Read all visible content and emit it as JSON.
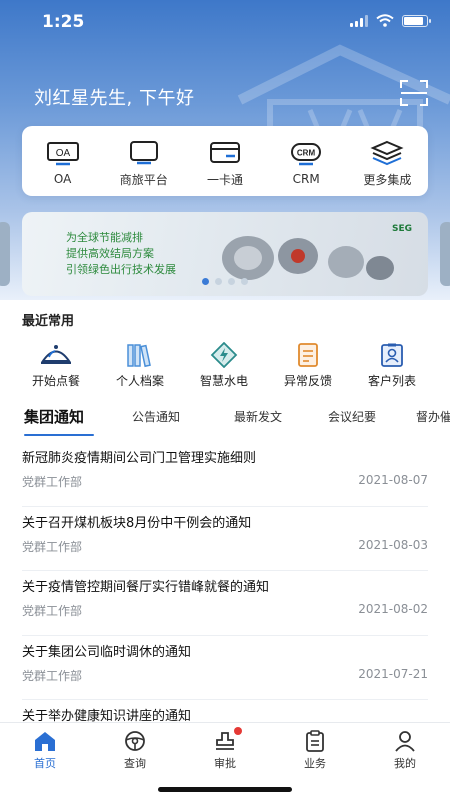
{
  "status_bar": {
    "time": "1:25",
    "battery_level": 0.85,
    "signal_icon": "signal-icon",
    "wifi_icon": "wifi-icon"
  },
  "header": {
    "greeting": "刘红星先生, 下午好",
    "scan_icon": "scan-icon"
  },
  "quick_apps": [
    {
      "label": "OA",
      "icon": "oa-icon"
    },
    {
      "label": "商旅平台",
      "icon": "travel-platform-icon"
    },
    {
      "label": "一卡通",
      "icon": "card-icon"
    },
    {
      "label": "CRM",
      "icon": "crm-icon"
    },
    {
      "label": "更多集成",
      "icon": "layers-icon"
    }
  ],
  "banner": {
    "lines": [
      "为全球节能减排",
      "提供高效结局方案",
      "引领绿色出行技术发展"
    ],
    "logo": "SEG",
    "page_count": 4,
    "active_page": 1
  },
  "recent": {
    "title": "最近常用",
    "items": [
      {
        "label": "开始点餐",
        "icon": "cloche-icon"
      },
      {
        "label": "个人档案",
        "icon": "books-icon"
      },
      {
        "label": "智慧水电",
        "icon": "energy-icon"
      },
      {
        "label": "异常反馈",
        "icon": "report-icon"
      },
      {
        "label": "客户列表",
        "icon": "contact-card-icon"
      }
    ]
  },
  "tabs": [
    "集团通知",
    "公告通知",
    "最新发文",
    "会议纪要",
    "督办催"
  ],
  "active_tab": 0,
  "news": [
    {
      "title": "新冠肺炎疫情期间公司门卫管理实施细则",
      "dept": "党群工作部",
      "date": "2021-08-07"
    },
    {
      "title": "关于召开煤机板块8月份中干例会的通知",
      "dept": "党群工作部",
      "date": "2021-08-03"
    },
    {
      "title": "关于疫情管控期间餐厅实行错峰就餐的通知",
      "dept": "党群工作部",
      "date": "2021-08-02"
    },
    {
      "title": "关于集团公司临时调休的通知",
      "dept": "党群工作部",
      "date": "2021-07-21"
    },
    {
      "title": "关于举办健康知识讲座的通知",
      "dept": "",
      "date": ""
    }
  ],
  "bottom_nav": [
    {
      "label": "首页",
      "icon": "home-icon",
      "active": true
    },
    {
      "label": "查询",
      "icon": "steering-wheel-icon"
    },
    {
      "label": "审批",
      "icon": "stamp-icon",
      "badge": true
    },
    {
      "label": "业务",
      "icon": "clipboard-icon"
    },
    {
      "label": "我的",
      "icon": "user-icon"
    }
  ],
  "colors": {
    "accent": "#2a6fd3",
    "header_top": "#3e78c9",
    "banner_green": "#2d8a3d",
    "badge_red": "#e53935"
  }
}
